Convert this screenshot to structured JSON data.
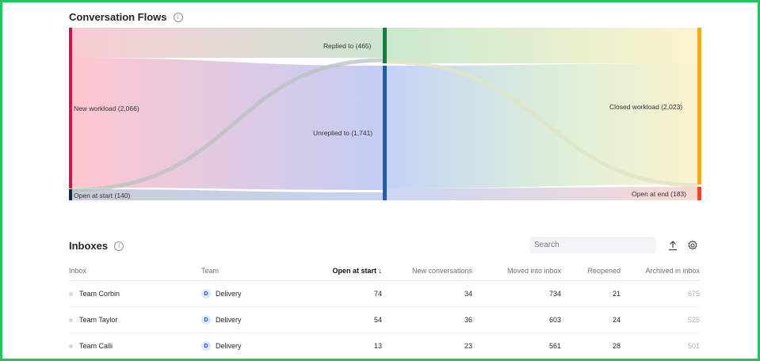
{
  "flows": {
    "title": "Conversation Flows",
    "info_icon": "info-icon",
    "nodes": {
      "new_workload": "New workload (2,066)",
      "open_at_start": "Open at start (140)",
      "replied_to": "Replied to (465)",
      "unreplied_to": "Unreplied to (1,741)",
      "closed_workload": "Closed workload (2,023)",
      "open_at_end": "Open at end (183)"
    },
    "colors": {
      "new_workload": "#c8174a",
      "open_at_start": "#0f2a3a",
      "replied_to": "#15803d",
      "unreplied_to": "#1f5fa8",
      "closed_workload": "#f2a623",
      "open_at_end": "#e04b2b"
    }
  },
  "inboxes": {
    "title": "Inboxes",
    "info_icon": "info-icon",
    "search_placeholder": "Search",
    "export_icon": "upload-icon",
    "settings_icon": "gear-icon",
    "columns": [
      "Inbox",
      "Team",
      "Open at start ↓",
      "New conversations",
      "Moved into inbox",
      "Reopened",
      "Archived in inbox"
    ],
    "rows": [
      {
        "inbox": "Team Corbin",
        "team_initial": "D",
        "team": "Delivery",
        "open_at_start": "74",
        "new_conversations": "34",
        "moved_into_inbox": "734",
        "reopened": "21",
        "archived_in_inbox": "675"
      },
      {
        "inbox": "Team Taylor",
        "team_initial": "D",
        "team": "Delivery",
        "open_at_start": "54",
        "new_conversations": "36",
        "moved_into_inbox": "603",
        "reopened": "24",
        "archived_in_inbox": "525"
      },
      {
        "inbox": "Team Calli",
        "team_initial": "D",
        "team": "Delivery",
        "open_at_start": "13",
        "new_conversations": "23",
        "moved_into_inbox": "561",
        "reopened": "28",
        "archived_in_inbox": "501"
      }
    ]
  }
}
